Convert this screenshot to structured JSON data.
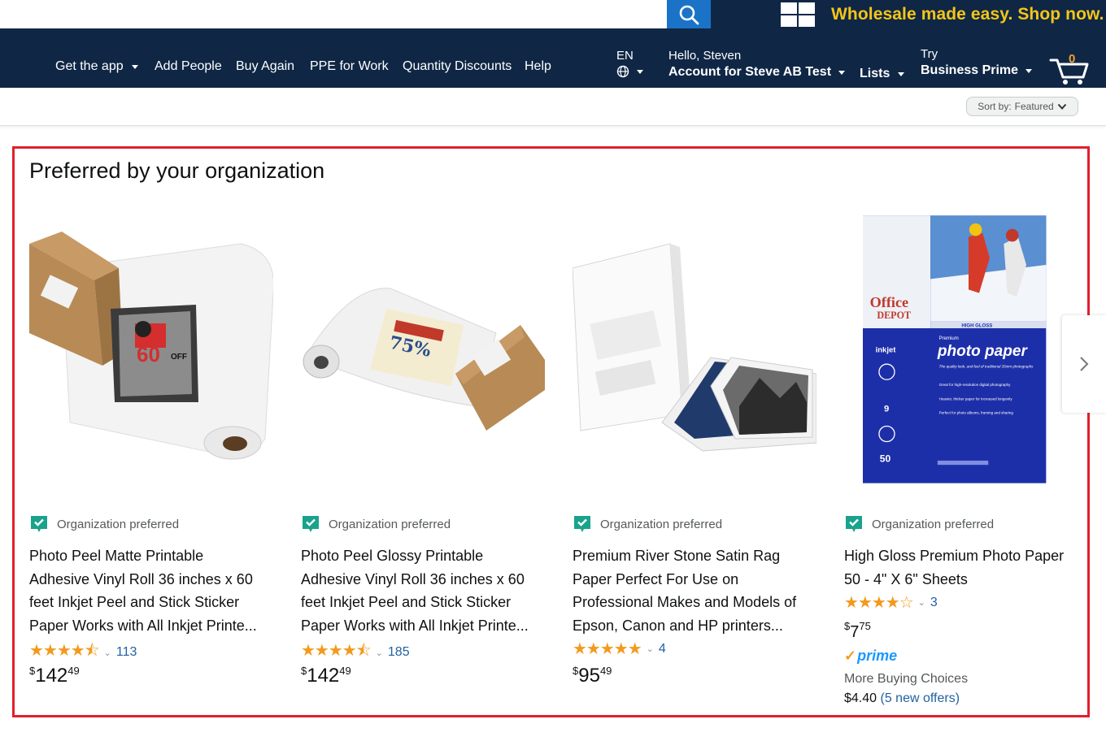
{
  "topbar": {
    "search_placeholder": "",
    "search_icon": "search-icon",
    "apps_icon": "grid-icon",
    "wholesale_banner": "Wholesale made easy. Shop now.",
    "colors": {
      "nav_bg": "#0f2745",
      "search_button": "#1a73c7",
      "banner_text": "#f5c518"
    }
  },
  "nav": {
    "items": [
      {
        "label": "Get the app",
        "has_caret": true
      },
      {
        "label": "Add People",
        "has_caret": false
      },
      {
        "label": "Buy Again",
        "has_caret": false
      },
      {
        "label": "PPE for Work",
        "has_caret": false
      },
      {
        "label": "Quantity Discounts",
        "has_caret": false
      },
      {
        "label": "Help",
        "has_caret": false
      }
    ],
    "language": {
      "code": "EN",
      "icon": "globe-icon"
    },
    "account": {
      "greeting": "Hello, Steven",
      "label": "Account for Steve AB Test"
    },
    "lists": "Lists",
    "business_prime": {
      "line1": "Try",
      "line2": "Business Prime"
    },
    "cart": {
      "count": "0",
      "icon": "cart-icon"
    }
  },
  "sort": {
    "label": "Sort by:",
    "value": "Featured"
  },
  "section": {
    "title": "Preferred by your organization",
    "border_color": "#e0202c",
    "products": [
      {
        "badge": "Organization preferred",
        "title_lines": [
          "Photo Peel Matte Printable",
          "Adhesive Vinyl Roll 36 inches x 60",
          "feet Inkjet Peel and Stick Sticker",
          "Paper Works with All Inkjet Printe..."
        ],
        "stars": "★★★★⯪",
        "rating": 4.5,
        "review_count": "113",
        "price": {
          "symbol": "$",
          "dollars": "142",
          "cents": "49"
        }
      },
      {
        "badge": "Organization preferred",
        "title_lines": [
          "Photo Peel Glossy Printable",
          "Adhesive Vinyl Roll 36 inches x 60",
          "feet Inkjet Peel and Stick Sticker",
          "Paper Works with All Inkjet Printe..."
        ],
        "stars": "★★★★⯪",
        "rating": 4.5,
        "review_count": "185",
        "price": {
          "symbol": "$",
          "dollars": "142",
          "cents": "49"
        }
      },
      {
        "badge": "Organization preferred",
        "title_lines": [
          "Premium River Stone Satin Rag",
          "Paper Perfect For Use on",
          "Professional Makes and Models of",
          "Epson, Canon and HP printers..."
        ],
        "stars": "★★★★★",
        "rating": 5,
        "review_count": "4",
        "price": {
          "symbol": "$",
          "dollars": "95",
          "cents": "49"
        }
      },
      {
        "badge": "Organization preferred",
        "title_lines": [
          "High Gloss Premium Photo Paper",
          "50 - 4\" X 6\" Sheets"
        ],
        "stars": "★★★★☆",
        "rating": 4,
        "review_count": "3",
        "price": {
          "symbol": "$",
          "dollars": "7",
          "cents": "75"
        },
        "prime_label": "prime",
        "more_buying": "More Buying Choices",
        "offer_price": "$4.40",
        "offer_link": "(5 new offers)",
        "image_text": {
          "brand_line1": "Office",
          "brand_line2": "DEPOT",
          "ribbon": "HIGH GLOSS",
          "kicker": "Premium",
          "headline": "photo paper",
          "tagline": "The quality look, and feel of traditional 35mm photographs",
          "features": [
            "Great for high-resolution digital photography",
            "Heavier, thicker paper for increased longevity",
            "Perfect for photo albums, framing and sharing"
          ],
          "spec1": "inkjet",
          "spec2": "9",
          "spec3": "50"
        }
      }
    ],
    "next_icon": "chevron-right-icon"
  }
}
